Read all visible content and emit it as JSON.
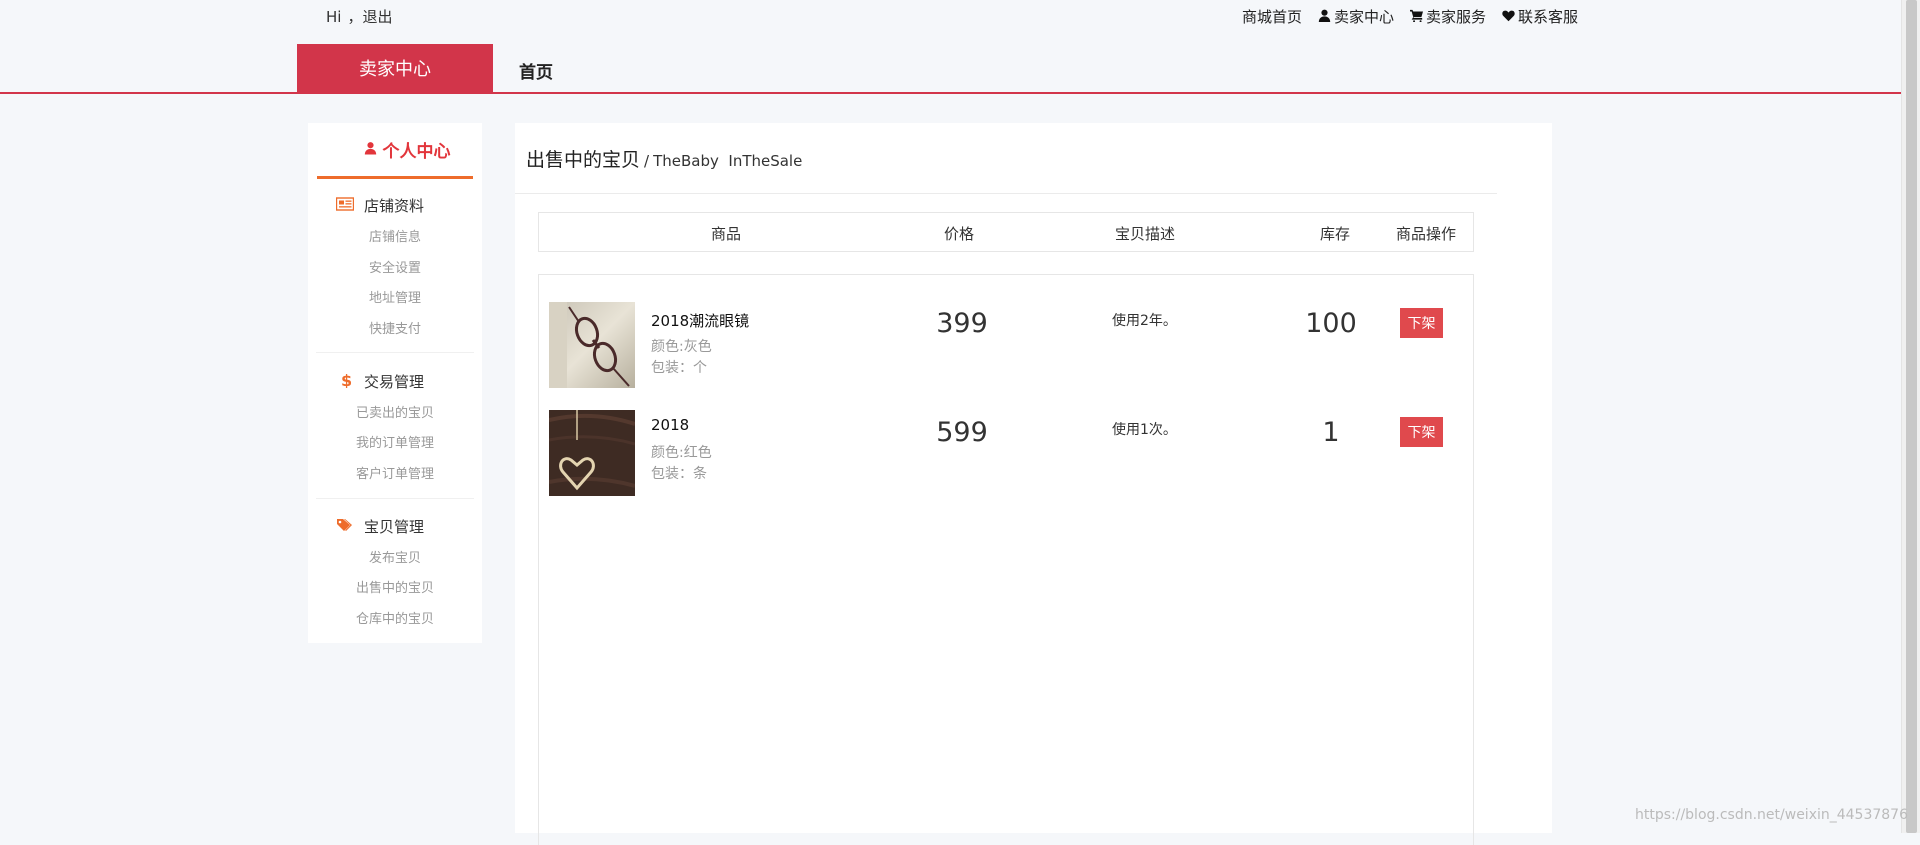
{
  "topbar": {
    "greeting": "Hi",
    "logout": "，退出",
    "links": [
      {
        "label": "商城首页",
        "icon": "none"
      },
      {
        "label": "卖家中心",
        "icon": "user-icon"
      },
      {
        "label": "卖家服务",
        "icon": "cart-icon"
      },
      {
        "label": "联系客服",
        "icon": "heart-icon"
      }
    ]
  },
  "nav": {
    "active_tab": "卖家中心",
    "home_tab": "首页"
  },
  "sidebar": {
    "title": "个人中心",
    "groups": [
      {
        "label": "店铺资料",
        "icon": "newspaper-icon",
        "items": [
          "店铺信息",
          "安全设置",
          "地址管理",
          "快捷支付"
        ]
      },
      {
        "label": "交易管理",
        "icon": "dollar-icon",
        "items": [
          "已卖出的宝贝",
          "我的订单管理",
          "客户订单管理"
        ]
      },
      {
        "label": "宝贝管理",
        "icon": "tags-icon",
        "items": [
          "发布宝贝",
          "出售中的宝贝",
          "仓库中的宝贝"
        ]
      }
    ]
  },
  "main": {
    "title": "出售中的宝贝",
    "separator": "/",
    "subtitle": "TheBaby  InTheSale",
    "columns": [
      "商品",
      "价格",
      "宝贝描述",
      "库存",
      "商品操作"
    ],
    "rows": [
      {
        "name": "2018潮流眼镜",
        "color": "颜色:灰色",
        "pack": "包装：个",
        "price": "399",
        "desc": "使用2年。",
        "stock": "100",
        "action": "下架"
      },
      {
        "name": "2018",
        "color": "颜色:红色",
        "pack": "包装：条",
        "price": "599",
        "desc": "使用1次。",
        "stock": "1",
        "action": "下架"
      }
    ]
  },
  "watermark": "https://blog.csdn.net/weixin_44537876",
  "colors": {
    "brand": "#d2354a",
    "accent": "#ee6c2b",
    "button": "#e0494d"
  }
}
